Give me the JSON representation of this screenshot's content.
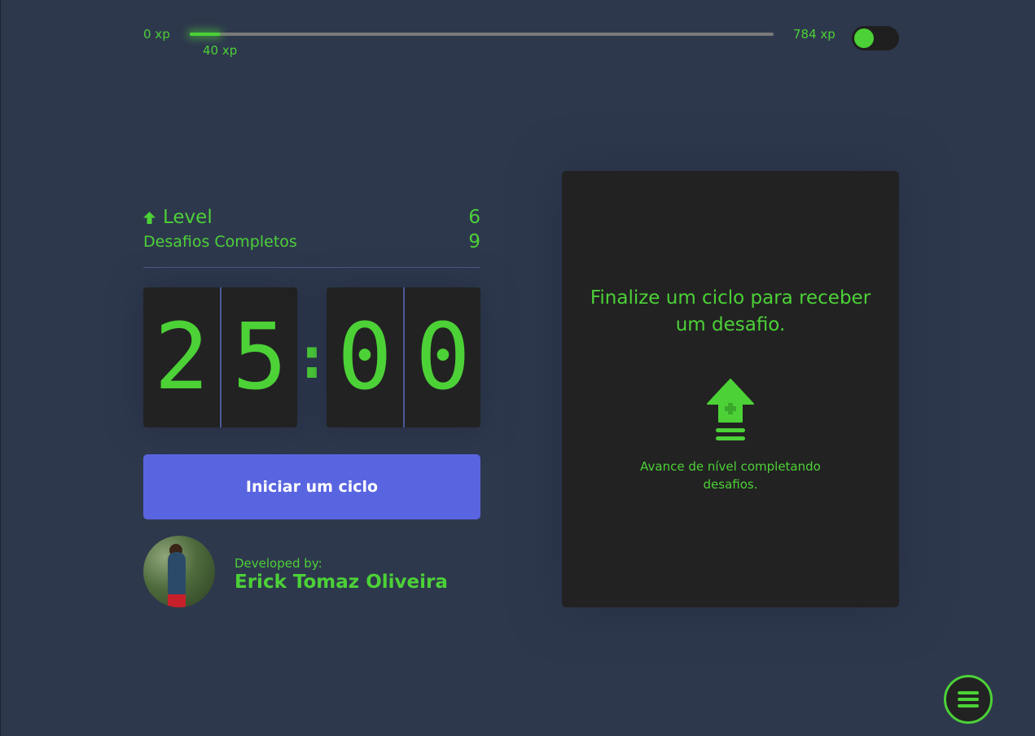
{
  "xp_bar": {
    "min_label": "0 xp",
    "max_label": "784 xp",
    "current_label": "40 xp",
    "progress_fraction": 0.051
  },
  "theme_toggle": {
    "state": "on",
    "color": "#4cd137"
  },
  "profile": {
    "level_label": "Level",
    "level_value": "6",
    "challenges_label": "Desafios Completos",
    "challenges_value": "9"
  },
  "countdown": {
    "minutes_left": "2",
    "minutes_right": "5",
    "separator": ":",
    "seconds_left": "0",
    "seconds_right": "0"
  },
  "start_button": {
    "label": "Iniciar um ciclo"
  },
  "developer": {
    "caption": "Developed by:",
    "name": "Erick Tomaz Oliveira"
  },
  "challenge_card": {
    "title": "Finalize um ciclo para receber um desafio.",
    "icon": "level-up-icon",
    "hint": "Avance de nível completando desafios."
  },
  "menu": {
    "icon": "menu-icon"
  },
  "colors": {
    "accent": "#4cd137",
    "background": "#2e384d",
    "card": "#222222",
    "button": "#5965e0"
  }
}
